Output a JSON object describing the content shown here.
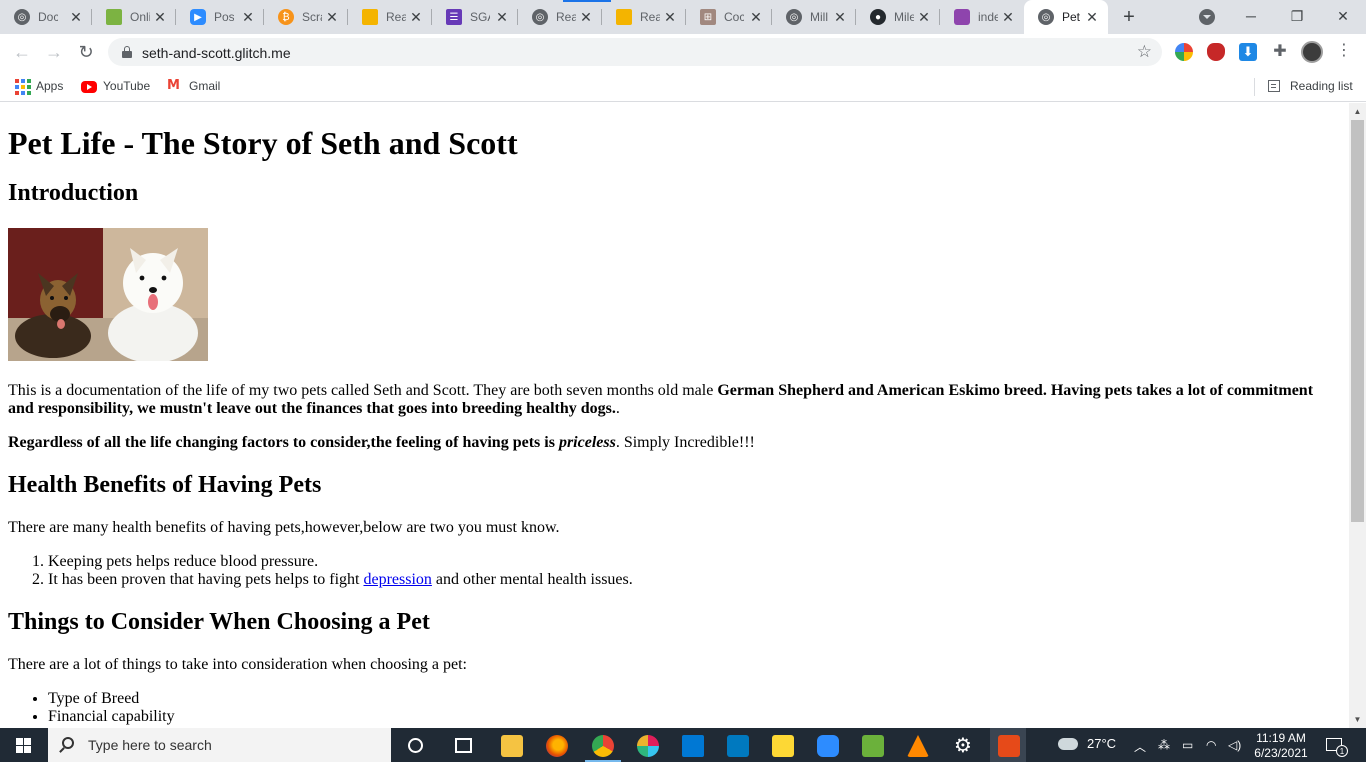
{
  "browser": {
    "tabs": [
      {
        "title": "Doc",
        "favicon": "globe-icon",
        "color": "#5f6368"
      },
      {
        "title": "Onli",
        "favicon": "gem-icon",
        "color": "#7cb342"
      },
      {
        "title": "Post",
        "favicon": "zoom-icon",
        "color": "#2d8cff"
      },
      {
        "title": "Scra",
        "favicon": "bitcoin-icon",
        "color": "#f7931a"
      },
      {
        "title": "Rea",
        "favicon": "slides-icon",
        "color": "#f4b400"
      },
      {
        "title": "SGA",
        "favicon": "forms-icon",
        "color": "#673ab7"
      },
      {
        "title": "Rea",
        "favicon": "globe-icon",
        "color": "#5f6368"
      },
      {
        "title": "Rea",
        "favicon": "slides-icon",
        "color": "#f4b400"
      },
      {
        "title": "Coc",
        "favicon": "grid-icon",
        "color": "#a1887f"
      },
      {
        "title": "Mill",
        "favicon": "globe-icon",
        "color": "#5f6368"
      },
      {
        "title": "Mile",
        "favicon": "github-icon",
        "color": "#24292e"
      },
      {
        "title": "inde",
        "favicon": "flag-icon",
        "color": "#8e44ad"
      },
      {
        "title": "Pet",
        "favicon": "globe-icon",
        "color": "#5f6368",
        "active": true
      }
    ],
    "address": {
      "url": "seth-and-scott.glitch.me"
    },
    "bookmarks": [
      {
        "label": "Apps",
        "icon": "apps-grid-icon"
      },
      {
        "label": "YouTube",
        "icon": "youtube-icon"
      },
      {
        "label": "Gmail",
        "icon": "gmail-icon"
      }
    ],
    "reading_list_label": "Reading list"
  },
  "page": {
    "title": "Pet Life - The Story of Seth and Scott",
    "intro_heading": "Introduction",
    "intro_p1_normal": "This is a documentation of the life of my two pets called Seth and Scott. They are both seven months old male ",
    "intro_p1_bold": "German Shepherd and American Eskimo breed. Having pets takes a lot of commitment and responsibility, we mustn't leave out the finances that goes into breeding healthy dogs.",
    "intro_p1_tail": ".",
    "intro_p2_bold": "Regardless of all the life changing factors to consider,the feeling of having pets is ",
    "intro_p2_italic": "priceless",
    "intro_p2_tail": ". Simply Incredible!!!",
    "health_heading": "Health Benefits of Having Pets",
    "health_p": "There are many health benefits of having pets,however,below are two you must know.",
    "health_item1": "Keeping pets helps reduce blood pressure.",
    "health_item2_pre": "It has been proven that having pets helps to fight ",
    "health_item2_link": "depression",
    "health_item2_post": " and other mental health issues.",
    "consider_heading": "Things to Consider When Choosing a Pet",
    "consider_p": "There are a lot of things to take into consideration when choosing a pet:",
    "consider_items": [
      "Type of Breed",
      "Financial capability"
    ]
  },
  "taskbar": {
    "search_placeholder": "Type here to search",
    "weather_temp": "27°C",
    "time": "11:19 AM",
    "date": "6/23/2021",
    "notification_count": "1"
  }
}
